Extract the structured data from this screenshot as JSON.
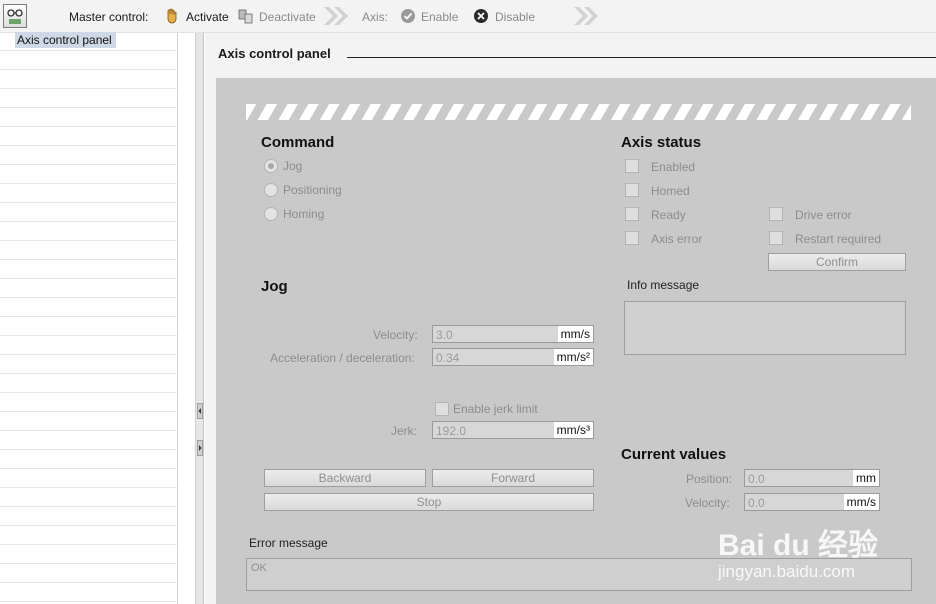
{
  "toolbar": {
    "master_control_label": "Master control:",
    "activate_label": "Activate",
    "deactivate_label": "Deactivate",
    "axis_label": "Axis:",
    "enable_label": "Enable",
    "disable_label": "Disable"
  },
  "tree": {
    "selected_item": "Axis control panel"
  },
  "main": {
    "title": "Axis control panel"
  },
  "command": {
    "heading": "Command",
    "options": [
      "Jog",
      "Positioning",
      "Homing"
    ],
    "selected": "Jog"
  },
  "axis_status": {
    "heading": "Axis status",
    "enabled": "Enabled",
    "homed": "Homed",
    "ready": "Ready",
    "axis_error": "Axis error",
    "drive_error": "Drive error",
    "restart_required": "Restart required",
    "confirm_label": "Confirm"
  },
  "info": {
    "label": "Info message",
    "text": ""
  },
  "jog": {
    "heading": "Jog",
    "velocity_label": "Velocity:",
    "velocity_value": "3.0",
    "velocity_unit": "mm/s",
    "accel_label": "Acceleration / deceleration:",
    "accel_value": "0.34",
    "accel_unit": "mm/s²",
    "jerk_enable_label": "Enable jerk limit",
    "jerk_label": "Jerk:",
    "jerk_value": "192.0",
    "jerk_unit": "mm/s³",
    "backward_label": "Backward",
    "forward_label": "Forward",
    "stop_label": "Stop"
  },
  "current": {
    "heading": "Current values",
    "position_label": "Position:",
    "position_value": "0.0",
    "position_unit": "mm",
    "velocity_label": "Velocity:",
    "velocity_value": "0.0",
    "velocity_unit": "mm/s"
  },
  "error": {
    "label": "Error message",
    "text": "OK"
  },
  "watermark": {
    "brand": "Bai du 经验",
    "url": "jingyan.baidu.com"
  },
  "colors": {
    "panel_bg": "#c9c9c9",
    "toolbar_bg": "#f3f3f3",
    "selection": "#cfd8e6"
  }
}
